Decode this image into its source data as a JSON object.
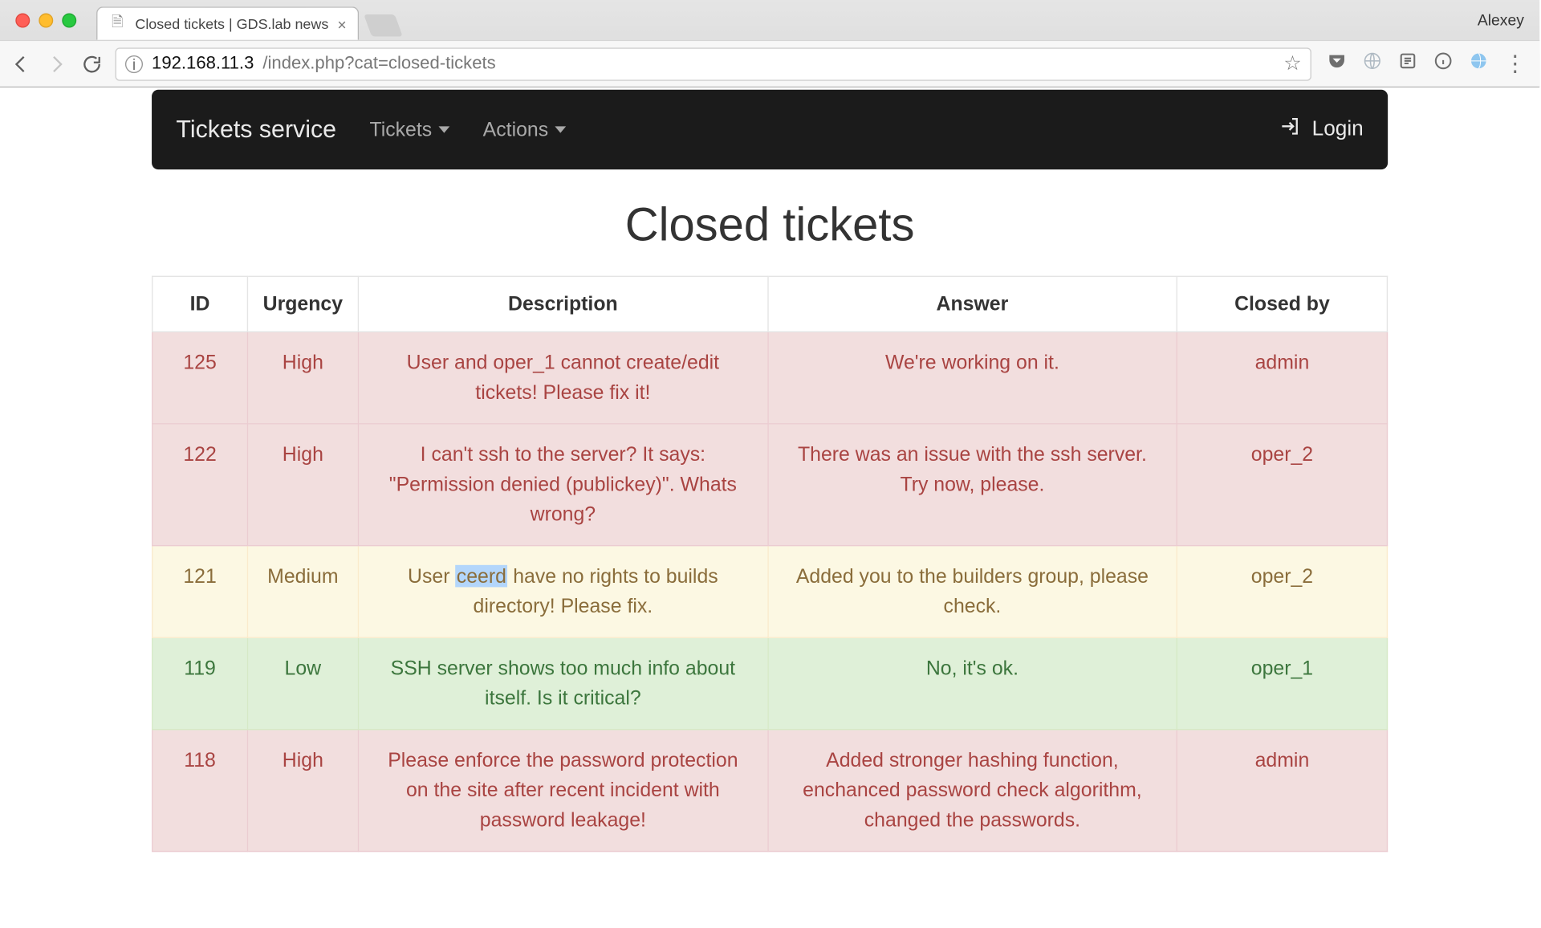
{
  "browser": {
    "tab_title": "Closed tickets | GDS.lab news",
    "profile": "Alexey",
    "url_host": "192.168.11.3",
    "url_path": "/index.php?cat=closed-tickets"
  },
  "navbar": {
    "brand": "Tickets service",
    "menu": [
      {
        "label": "Tickets"
      },
      {
        "label": "Actions"
      }
    ],
    "login_label": "Login"
  },
  "page_title": "Closed tickets",
  "table": {
    "headers": [
      "ID",
      "Urgency",
      "Description",
      "Answer",
      "Closed by"
    ],
    "rows": [
      {
        "id": "125",
        "urgency": "High",
        "urgency_class": "high",
        "description": "User and oper_1 cannot create/edit tickets! Please fix it!",
        "answer": "We're working on it.",
        "closed_by": "admin"
      },
      {
        "id": "122",
        "urgency": "High",
        "urgency_class": "high",
        "description": "I can't ssh to the server? It says: \"Permission denied (publickey)\". Whats wrong?",
        "answer": "There was an issue with the ssh server. Try now, please.",
        "closed_by": "oper_2"
      },
      {
        "id": "121",
        "urgency": "Medium",
        "urgency_class": "medium",
        "description_pre": "User ",
        "description_sel": "ceerd",
        "description_post": " have no rights to builds directory! Please fix.",
        "answer": "Added you to the builders group, please check.",
        "closed_by": "oper_2"
      },
      {
        "id": "119",
        "urgency": "Low",
        "urgency_class": "low",
        "description": "SSH server shows too much info about itself. Is it critical?",
        "answer": "No, it's ok.",
        "closed_by": "oper_1"
      },
      {
        "id": "118",
        "urgency": "High",
        "urgency_class": "high",
        "description": "Please enforce the password protection on the site after recent incident with password leakage!",
        "answer": "Added stronger hashing function, enchanced password check algorithm, changed the passwords.",
        "closed_by": "admin"
      }
    ]
  }
}
